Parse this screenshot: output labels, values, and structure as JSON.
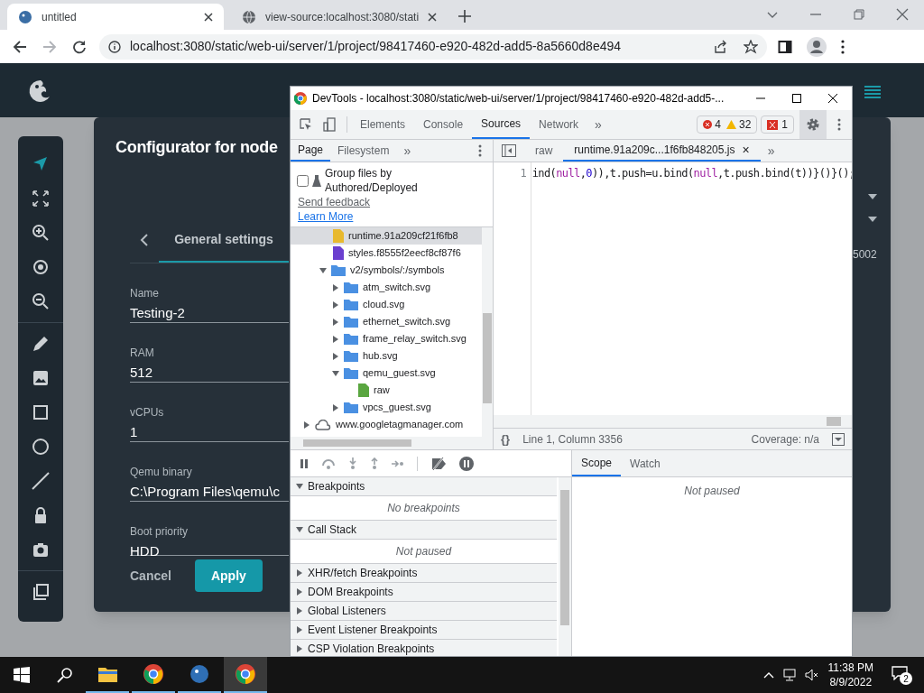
{
  "browser": {
    "tabs": [
      {
        "title": "untitled",
        "selected": true,
        "kind": "app"
      },
      {
        "title": "view-source:localhost:3080/stati",
        "selected": false,
        "kind": "web"
      }
    ],
    "url": "localhost:3080/static/web-ui/server/1/project/98417460-e920-482d-add5-8a5660d8e494"
  },
  "app": {
    "dialog": {
      "title": "Configurator for node",
      "tabs": [
        {
          "label": "General settings",
          "selected": true
        }
      ],
      "fields": [
        {
          "label": "Name",
          "value": "Testing-2"
        },
        {
          "label": "RAM",
          "value": "512"
        },
        {
          "label": "vCPUs",
          "value": "1"
        },
        {
          "label": "Qemu binary",
          "value": "C:\\Program Files\\qemu\\c"
        },
        {
          "label": "Boot priority",
          "value": "HDD"
        }
      ],
      "cancel": "Cancel",
      "apply": "Apply",
      "side_value": "5002"
    }
  },
  "devtools": {
    "title": "DevTools - localhost:3080/static/web-ui/server/1/project/98417460-e920-482d-add5-...",
    "panels": [
      {
        "label": "Elements",
        "selected": false
      },
      {
        "label": "Console",
        "selected": false
      },
      {
        "label": "Sources",
        "selected": true
      },
      {
        "label": "Network",
        "selected": false
      }
    ],
    "more": "»",
    "errors": "4",
    "warnings": "32",
    "issues": "1",
    "navigator_tabs": [
      {
        "label": "Page",
        "selected": true
      },
      {
        "label": "Filesystem",
        "selected": false
      }
    ],
    "navigator_more": "»",
    "group_files": {
      "label": "Group files by Authored/Deployed",
      "checked": false
    },
    "links": [
      "Send feedback",
      "Learn More"
    ],
    "tree": [
      {
        "name": "runtime.91a209cf21f6fb8",
        "kind": "file",
        "color": "#e8b92e",
        "selected": true
      },
      {
        "name": "styles.f8555f2eecf8cf87f6",
        "kind": "file",
        "color": "#6b3fcf",
        "selected": false
      },
      {
        "name": "v2/symbols/:/symbols",
        "kind": "folder",
        "expanded": true,
        "selected": false,
        "children": [
          {
            "name": "atm_switch.svg",
            "kind": "folder",
            "expanded": false,
            "selected": false
          },
          {
            "name": "cloud.svg",
            "kind": "folder",
            "expanded": false,
            "selected": false
          },
          {
            "name": "ethernet_switch.svg",
            "kind": "folder",
            "expanded": false,
            "selected": false
          },
          {
            "name": "frame_relay_switch.svg",
            "kind": "folder",
            "expanded": false,
            "selected": false
          },
          {
            "name": "hub.svg",
            "kind": "folder",
            "expanded": false,
            "selected": false
          },
          {
            "name": "qemu_guest.svg",
            "kind": "folder",
            "expanded": true,
            "selected": false,
            "children": [
              {
                "name": "raw",
                "kind": "file",
                "color": "#5aa640",
                "selected": false
              }
            ]
          },
          {
            "name": "vpcs_guest.svg",
            "kind": "folder",
            "expanded": false,
            "selected": false
          }
        ]
      },
      {
        "name": "www.googletagmanager.com",
        "kind": "domain",
        "expanded": false,
        "selected": false
      }
    ],
    "editor_tabs": [
      {
        "label": "raw",
        "selected": false,
        "closable": false
      },
      {
        "label": "runtime.91a209c...1f6fb848205.js",
        "selected": true,
        "closable": true
      }
    ],
    "editor_more": "»",
    "close": "×",
    "line_number": "1",
    "code": [
      {
        "text": "ind(",
        "kind": "plain"
      },
      {
        "text": "null",
        "kind": "keyword"
      },
      {
        "text": ",",
        "kind": "plain"
      },
      {
        "text": "0",
        "kind": "number"
      },
      {
        "text": ")),t.push=u.bind(",
        "kind": "plain"
      },
      {
        "text": "null",
        "kind": "keyword"
      },
      {
        "text": ",t.push.bind(t))}()}();",
        "kind": "plain"
      }
    ],
    "format": "{}",
    "position": "Line 1, Column 3356",
    "coverage": "Coverage: n/a",
    "sections": [
      {
        "title": "Breakpoints",
        "expanded": true,
        "empty_text": "No breakpoints"
      },
      {
        "title": "Call Stack",
        "expanded": true,
        "empty_text": "Not paused"
      },
      {
        "title": "XHR/fetch Breakpoints",
        "expanded": false
      },
      {
        "title": "DOM Breakpoints",
        "expanded": false
      },
      {
        "title": "Global Listeners",
        "expanded": false
      },
      {
        "title": "Event Listener Breakpoints",
        "expanded": false
      },
      {
        "title": "CSP Violation Breakpoints",
        "expanded": false
      }
    ],
    "side_tabs": [
      {
        "label": "Scope",
        "selected": true
      },
      {
        "label": "Watch",
        "selected": false
      }
    ],
    "side_text": "Not paused"
  },
  "taskbar": {
    "time": "11:38 PM",
    "date": "8/9/2022",
    "notifications": "2"
  }
}
